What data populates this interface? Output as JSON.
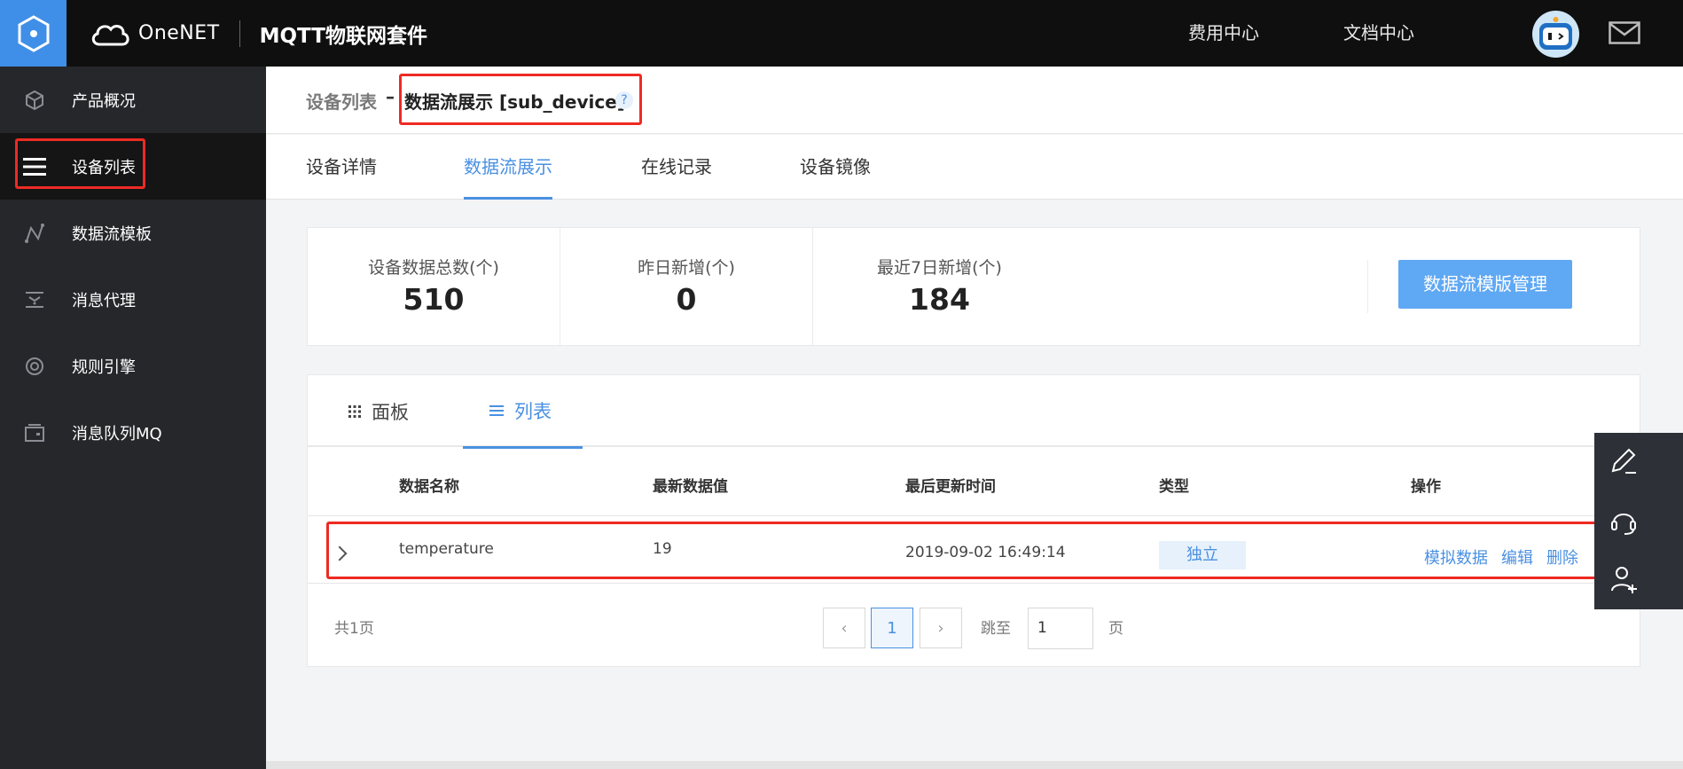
{
  "header": {
    "brand_name": "OneNET",
    "product_name": "MQTT物联网套件",
    "links": [
      "费用中心",
      "文档中心"
    ]
  },
  "sidebar": {
    "items": [
      {
        "label": "产品概况",
        "icon": "cube-icon"
      },
      {
        "label": "设备列表",
        "icon": "list-icon",
        "active": true
      },
      {
        "label": "数据流模板",
        "icon": "datastream-icon"
      },
      {
        "label": "消息代理",
        "icon": "message-proxy-icon"
      },
      {
        "label": "规则引擎",
        "icon": "rule-engine-icon"
      },
      {
        "label": "消息队列MQ",
        "icon": "queue-icon"
      }
    ]
  },
  "breadcrumb": {
    "parent": "设备列表",
    "separator": "–",
    "current": "数据流展示 [sub_device]",
    "help": "?"
  },
  "tabs": [
    {
      "label": "设备详情"
    },
    {
      "label": "数据流展示",
      "active": true
    },
    {
      "label": "在线记录"
    },
    {
      "label": "设备镜像"
    }
  ],
  "stats": [
    {
      "label": "设备数据总数(个)",
      "value": "510"
    },
    {
      "label": "昨日新增(个)",
      "value": "0"
    },
    {
      "label": "最近7日新增(个)",
      "value": "184"
    }
  ],
  "manage_button": "数据流模版管理",
  "view_tabs": [
    {
      "label": "面板",
      "icon": "grid-icon"
    },
    {
      "label": "列表",
      "icon": "list-lines-icon",
      "active": true
    }
  ],
  "table": {
    "columns": [
      "数据名称",
      "最新数据值",
      "最后更新时间",
      "类型",
      "操作"
    ],
    "rows": [
      {
        "name": "temperature",
        "value": "19",
        "updated": "2019-09-02 16:49:14",
        "type": "独立",
        "actions": [
          "模拟数据",
          "编辑",
          "删除"
        ]
      }
    ]
  },
  "pagination": {
    "total": "共1页",
    "prev": "‹",
    "current": "1",
    "next": "›",
    "jump_label": "跳至",
    "jump_value": "1",
    "page_suffix": "页"
  },
  "colors": {
    "accent": "#4a90e2",
    "highlight": "#ee2a24",
    "topbar": "#0f0f0f",
    "sidebar": "#26272b"
  }
}
